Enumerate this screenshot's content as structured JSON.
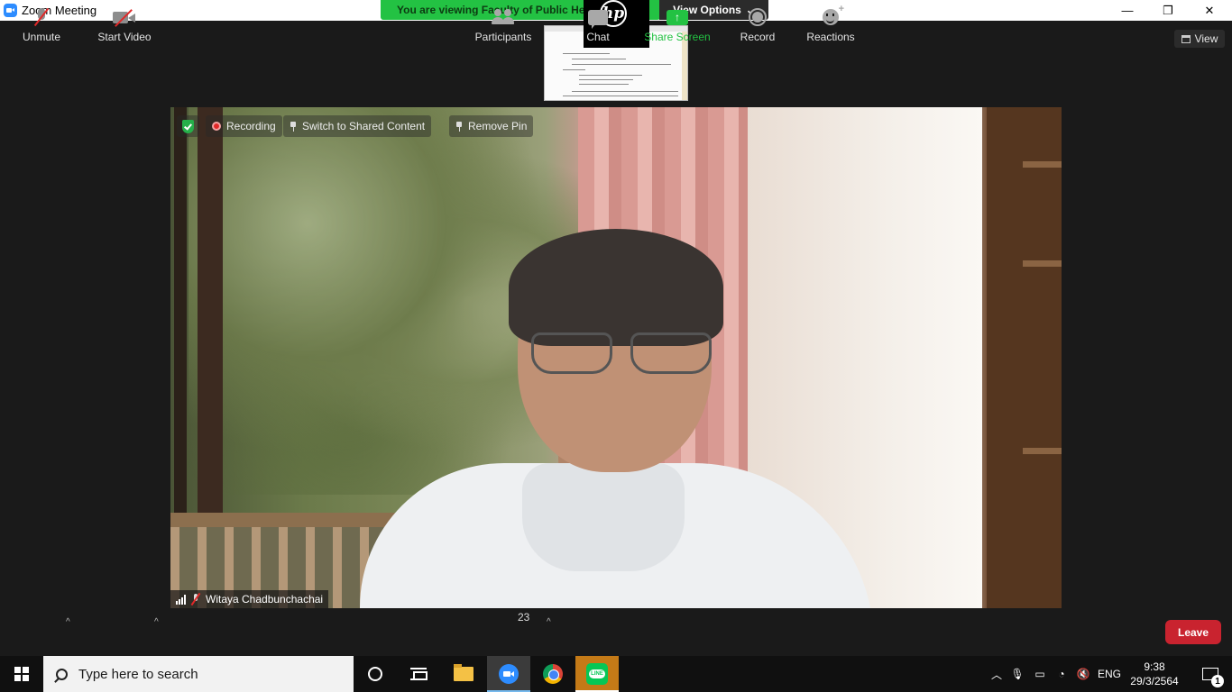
{
  "window": {
    "title": "Zoom Meeting",
    "controls": {
      "minimize": "—",
      "restore": "❐",
      "close": "✕"
    }
  },
  "share_banner": {
    "text": "You are viewing Faculty of Public Hea",
    "view_options": "View Options",
    "color": "#23c243"
  },
  "thumbnail": {
    "logo": "hp"
  },
  "view_button": {
    "label": "View"
  },
  "video_overlay": {
    "recording": "Recording",
    "switch": "Switch to Shared Content",
    "remove_pin": "Remove Pin"
  },
  "participant": {
    "name": "Witaya Chadbunchachai"
  },
  "toolbar": {
    "unmute": "Unmute",
    "start_video": "Start Video",
    "participants": "Participants",
    "participants_count": "23",
    "chat": "Chat",
    "share_screen": "Share Screen",
    "record": "Record",
    "reactions": "Reactions",
    "leave": "Leave",
    "leave_color": "#c9232f"
  },
  "taskbar": {
    "search_placeholder": "Type here to search",
    "language": "ENG",
    "time": "9:38",
    "date": "29/3/2564",
    "notification_count": "1",
    "line_app_label": "LINE"
  }
}
